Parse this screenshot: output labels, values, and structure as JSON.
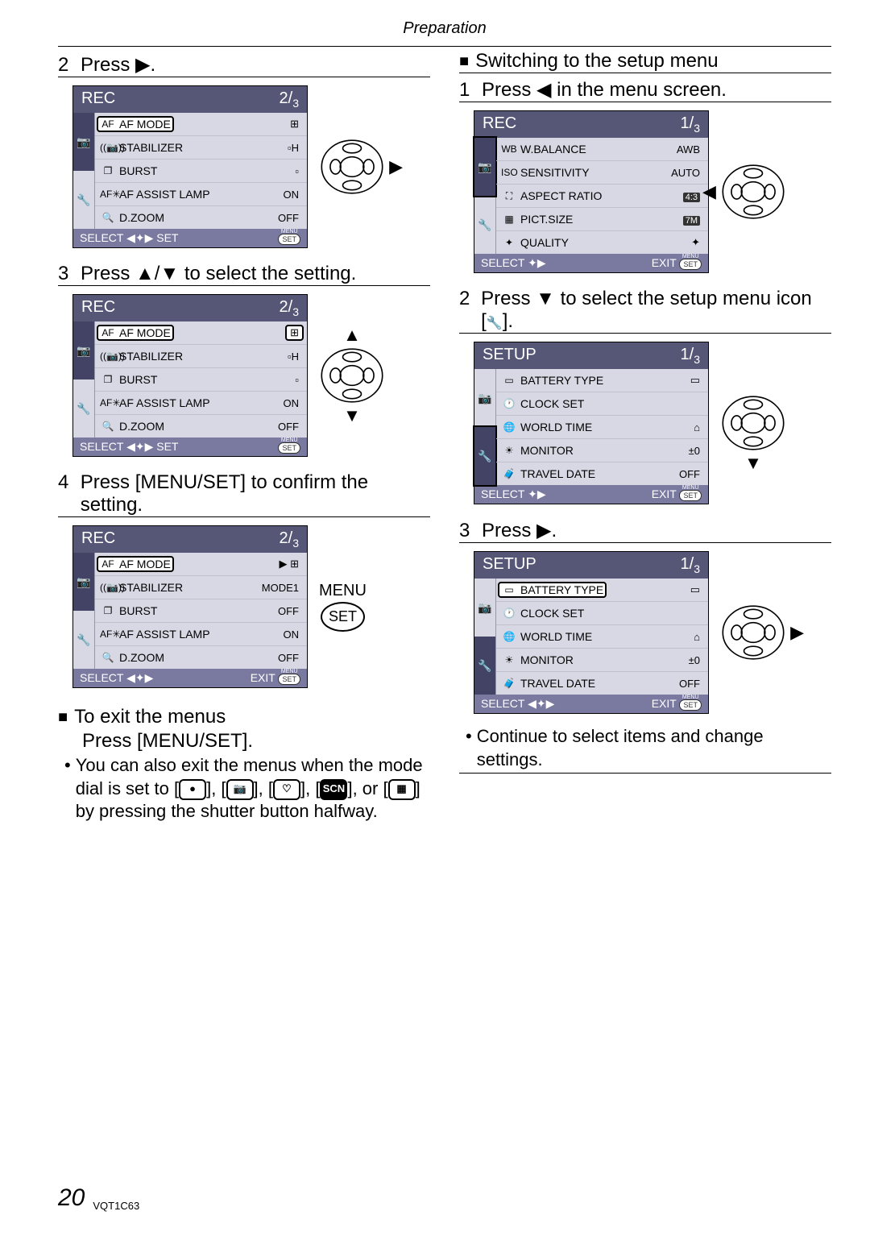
{
  "header": "Preparation",
  "left": {
    "step2": {
      "num": "2",
      "text": "Press ▶."
    },
    "menu2": {
      "title": "REC",
      "page": "2",
      "total": "3",
      "rows": [
        {
          "icon": "AF",
          "label": "AF MODE",
          "val": "⊞",
          "hl": true,
          "valhl": false
        },
        {
          "icon": "((📷))",
          "label": "STABILIZER",
          "val": "▫H"
        },
        {
          "icon": "❐",
          "label": "BURST",
          "val": "▫"
        },
        {
          "icon": "AF✳",
          "label": "AF ASSIST LAMP",
          "val": "ON"
        },
        {
          "icon": "🔍",
          "label": "D.ZOOM",
          "val": "OFF"
        }
      ],
      "footer_left": "SELECT ◀✦▶ SET",
      "footer_right": "SET"
    },
    "step3": {
      "num": "3",
      "text": "Press ▲/▼ to select the setting."
    },
    "menu3": {
      "title": "REC",
      "page": "2",
      "total": "3",
      "rows": [
        {
          "icon": "AF",
          "label": "AF MODE",
          "val": "⊞",
          "hl": true,
          "valhl": true
        },
        {
          "icon": "((📷))",
          "label": "STABILIZER",
          "val": "▫H"
        },
        {
          "icon": "❐",
          "label": "BURST",
          "val": "▫"
        },
        {
          "icon": "AF✳",
          "label": "AF ASSIST LAMP",
          "val": "ON"
        },
        {
          "icon": "🔍",
          "label": "D.ZOOM",
          "val": "OFF"
        }
      ],
      "footer_left": "SELECT ◀✦▶ SET",
      "footer_right": "SET"
    },
    "step4": {
      "num": "4",
      "text": "Press [MENU/SET] to confirm the setting."
    },
    "menu4": {
      "title": "REC",
      "page": "2",
      "total": "3",
      "rows": [
        {
          "icon": "AF",
          "label": "AF MODE",
          "val": "▶ ⊞",
          "hl": true,
          "valhl": false
        },
        {
          "icon": "((📷))",
          "label": "STABILIZER",
          "val": "MODE1"
        },
        {
          "icon": "❐",
          "label": "BURST",
          "val": "OFF"
        },
        {
          "icon": "AF✳",
          "label": "AF ASSIST LAMP",
          "val": "ON"
        },
        {
          "icon": "🔍",
          "label": "D.ZOOM",
          "val": "OFF"
        }
      ],
      "footer_left": "SELECT ◀✦▶",
      "footer_right": "EXIT",
      "footer_pill": "SET"
    },
    "menu4_side": "MENU",
    "menu4_side2": "SET",
    "exit_head": "To exit the menus",
    "exit_line": "Press [MENU/SET].",
    "exit_bullet": "You can also exit the menus when the mode dial is set to [",
    "exit_bullet2": "], [",
    "exit_bullet3": "], [",
    "exit_bullet4": "], [",
    "exit_bullet5": "], or [",
    "exit_bullet6": "] by pressing the shutter button halfway."
  },
  "right": {
    "switch_head": "Switching to the setup menu",
    "step1": {
      "num": "1",
      "text": "Press ◀ in the menu screen."
    },
    "menu1": {
      "title": "REC",
      "page": "1",
      "total": "3",
      "rows": [
        {
          "icon": "WB",
          "label": "W.BALANCE",
          "val": "AWB"
        },
        {
          "icon": "ISO",
          "label": "SENSITIVITY",
          "val": "AUTO"
        },
        {
          "icon": "⛶",
          "label": "ASPECT RATIO",
          "val": "4:3",
          "dark": true
        },
        {
          "icon": "▦",
          "label": "PICT.SIZE",
          "val": "7M",
          "dark": true
        },
        {
          "icon": "✦",
          "label": "QUALITY",
          "val": "✦"
        }
      ],
      "footer_left": "SELECT ✦▶",
      "footer_right": "EXIT",
      "footer_pill": "SET",
      "side_hl": true
    },
    "step2": {
      "num": "2",
      "text": "Press ▼ to select the setup menu icon [",
      "text_end": "]."
    },
    "menu2": {
      "title": "SETUP",
      "page": "1",
      "total": "3",
      "rows": [
        {
          "icon": "▭",
          "label": "BATTERY TYPE",
          "val": "▭"
        },
        {
          "icon": "🕐",
          "label": "CLOCK SET",
          "val": ""
        },
        {
          "icon": "🌐",
          "label": "WORLD TIME",
          "val": "⌂"
        },
        {
          "icon": "☀",
          "label": "MONITOR",
          "val": "±0"
        },
        {
          "icon": "🧳",
          "label": "TRAVEL DATE",
          "val": "OFF"
        }
      ],
      "footer_left": "SELECT ✦▶",
      "footer_right": "EXIT",
      "footer_pill": "SET",
      "side_hl_bottom": true
    },
    "step3": {
      "num": "3",
      "text": "Press ▶."
    },
    "menu3": {
      "title": "SETUP",
      "page": "1",
      "total": "3",
      "rows": [
        {
          "icon": "▭",
          "label": "BATTERY TYPE",
          "val": "▭",
          "hl": true
        },
        {
          "icon": "🕐",
          "label": "CLOCK SET",
          "val": ""
        },
        {
          "icon": "🌐",
          "label": "WORLD TIME",
          "val": "⌂"
        },
        {
          "icon": "☀",
          "label": "MONITOR",
          "val": "±0"
        },
        {
          "icon": "🧳",
          "label": "TRAVEL DATE",
          "val": "OFF"
        }
      ],
      "footer_left": "SELECT ◀✦▶",
      "footer_right": "EXIT",
      "footer_pill": "SET"
    },
    "closing_bullet": "Continue to select items and change settings."
  },
  "footer": {
    "page": "20",
    "id": "VQT1C63"
  },
  "glyphs": {
    "right": "▶",
    "left": "◀",
    "up": "▲",
    "down": "▼",
    "square": "■",
    "wrench": "🔧"
  }
}
